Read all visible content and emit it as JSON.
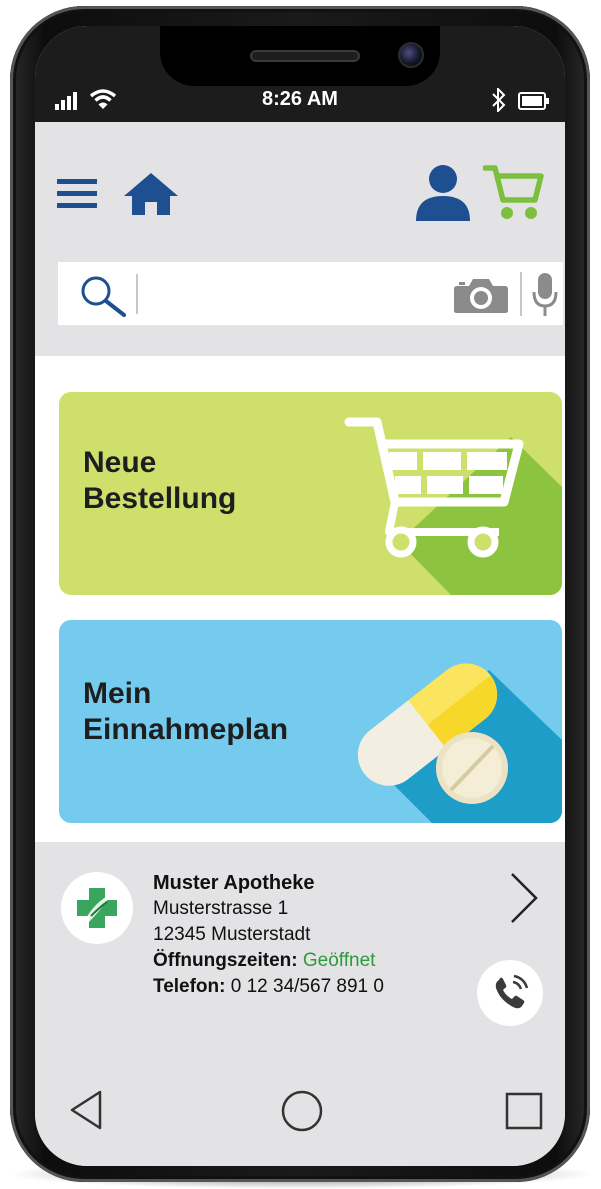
{
  "status_bar": {
    "time": "8:26 AM"
  },
  "header": {
    "menu_icon": "hamburger-menu-icon",
    "home_icon": "home-icon",
    "user_icon": "user-icon",
    "cart_icon": "shopping-cart-icon"
  },
  "search": {
    "value": "",
    "placeholder": "",
    "icons": [
      "search-icon",
      "camera-icon",
      "microphone-icon"
    ]
  },
  "tiles": [
    {
      "title": "Neue\nBestellung",
      "icon": "shopping-cart-icon",
      "color": "#cfdf6c"
    },
    {
      "title": "Mein\nEinnahmeplan",
      "icon": "pill-icon",
      "color": "#74cbed"
    }
  ],
  "pharmacy": {
    "name": "Muster Apotheke",
    "street": "Musterstrasse 1",
    "city": "12345 Musterstadt",
    "hours_label": "Öffnungszeiten:",
    "hours_status": "Geöffnet",
    "phone_label": "Telefon:",
    "phone_number": "0 12 34/567 891 0"
  },
  "nav": {
    "icons": [
      "back-icon",
      "home-circle-icon",
      "recent-apps-icon"
    ]
  },
  "colors": {
    "brand_blue": "#1d4f91",
    "cart_green": "#7cbf3f",
    "status_open": "#2f9a3b"
  }
}
